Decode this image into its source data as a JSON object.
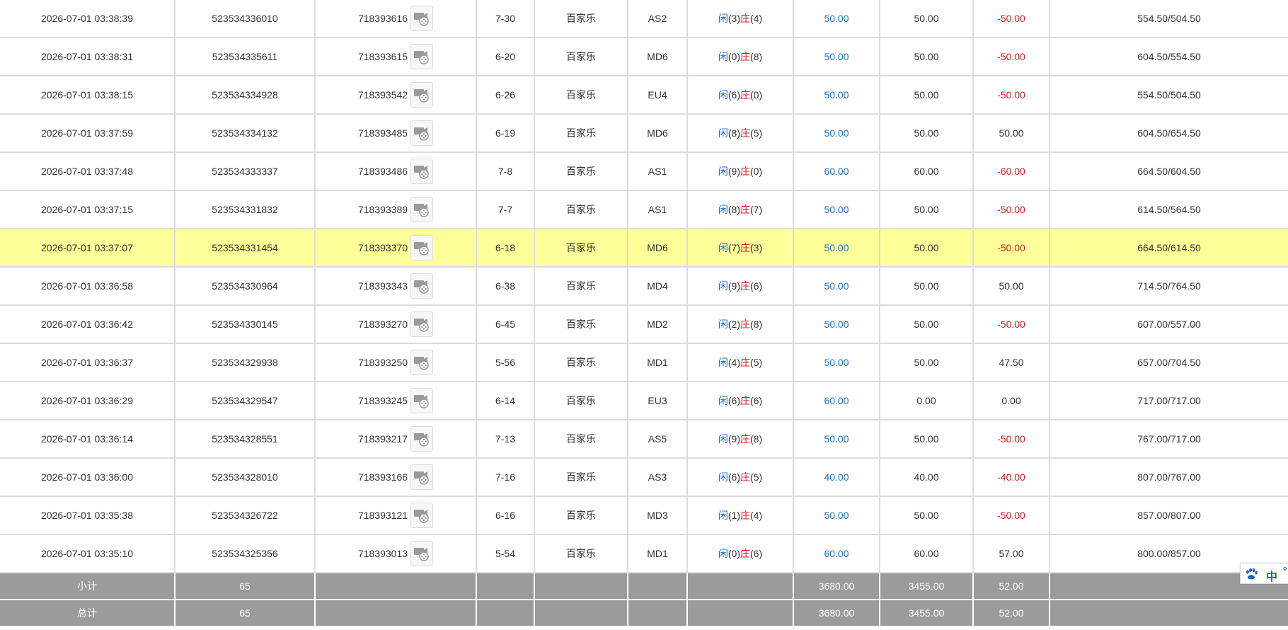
{
  "rows": [
    {
      "time": "2026-07-01 03:38:39",
      "order_no": "523534336010",
      "round_no": "718393616",
      "shoe": "7-30",
      "game": "百家乐",
      "table": "AS2",
      "player_label": "闲",
      "player_pts": "(3)",
      "banker_label": "庄",
      "banker_pts": "(4)",
      "bet": "50.00",
      "valid": "50.00",
      "payout": "-50.00",
      "payout_neg": true,
      "balance": "554.50/504.50",
      "highlight": false
    },
    {
      "time": "2026-07-01 03:38:31",
      "order_no": "523534335611",
      "round_no": "718393615",
      "shoe": "6-20",
      "game": "百家乐",
      "table": "MD6",
      "player_label": "闲",
      "player_pts": "(0)",
      "banker_label": "庄",
      "banker_pts": "(8)",
      "bet": "50.00",
      "valid": "50.00",
      "payout": "-50.00",
      "payout_neg": true,
      "balance": "604.50/554.50",
      "highlight": false
    },
    {
      "time": "2026-07-01 03:38:15",
      "order_no": "523534334928",
      "round_no": "718393542",
      "shoe": "6-26",
      "game": "百家乐",
      "table": "EU4",
      "player_label": "闲",
      "player_pts": "(6)",
      "banker_label": "庄",
      "banker_pts": "(0)",
      "bet": "50.00",
      "valid": "50.00",
      "payout": "-50.00",
      "payout_neg": true,
      "balance": "554.50/504.50",
      "highlight": false
    },
    {
      "time": "2026-07-01 03:37:59",
      "order_no": "523534334132",
      "round_no": "718393485",
      "shoe": "6-19",
      "game": "百家乐",
      "table": "MD6",
      "player_label": "闲",
      "player_pts": "(8)",
      "banker_label": "庄",
      "banker_pts": "(5)",
      "bet": "50.00",
      "valid": "50.00",
      "payout": "50.00",
      "payout_neg": false,
      "balance": "604.50/654.50",
      "highlight": false
    },
    {
      "time": "2026-07-01 03:37:48",
      "order_no": "523534333337",
      "round_no": "718393486",
      "shoe": "7-8",
      "game": "百家乐",
      "table": "AS1",
      "player_label": "闲",
      "player_pts": "(9)",
      "banker_label": "庄",
      "banker_pts": "(0)",
      "bet": "60.00",
      "valid": "60.00",
      "payout": "-60.00",
      "payout_neg": true,
      "balance": "664.50/604.50",
      "highlight": false
    },
    {
      "time": "2026-07-01 03:37:15",
      "order_no": "523534331832",
      "round_no": "718393389",
      "shoe": "7-7",
      "game": "百家乐",
      "table": "AS1",
      "player_label": "闲",
      "player_pts": "(8)",
      "banker_label": "庄",
      "banker_pts": "(7)",
      "bet": "50.00",
      "valid": "50.00",
      "payout": "-50.00",
      "payout_neg": true,
      "balance": "614.50/564.50",
      "highlight": false
    },
    {
      "time": "2026-07-01 03:37:07",
      "order_no": "523534331454",
      "round_no": "718393370",
      "shoe": "6-18",
      "game": "百家乐",
      "table": "MD6",
      "player_label": "闲",
      "player_pts": "(7)",
      "banker_label": "庄",
      "banker_pts": "(3)",
      "bet": "50.00",
      "valid": "50.00",
      "payout": "-50.00",
      "payout_neg": true,
      "balance": "664.50/614.50",
      "highlight": true
    },
    {
      "time": "2026-07-01 03:36:58",
      "order_no": "523534330964",
      "round_no": "718393343",
      "shoe": "6-38",
      "game": "百家乐",
      "table": "MD4",
      "player_label": "闲",
      "player_pts": "(9)",
      "banker_label": "庄",
      "banker_pts": "(6)",
      "bet": "50.00",
      "valid": "50.00",
      "payout": "50.00",
      "payout_neg": false,
      "balance": "714.50/764.50",
      "highlight": false
    },
    {
      "time": "2026-07-01 03:36:42",
      "order_no": "523534330145",
      "round_no": "718393270",
      "shoe": "6-45",
      "game": "百家乐",
      "table": "MD2",
      "player_label": "闲",
      "player_pts": "(2)",
      "banker_label": "庄",
      "banker_pts": "(8)",
      "bet": "50.00",
      "valid": "50.00",
      "payout": "-50.00",
      "payout_neg": true,
      "balance": "607.00/557.00",
      "highlight": false
    },
    {
      "time": "2026-07-01 03:36:37",
      "order_no": "523534329938",
      "round_no": "718393250",
      "shoe": "5-56",
      "game": "百家乐",
      "table": "MD1",
      "player_label": "闲",
      "player_pts": "(4)",
      "banker_label": "庄",
      "banker_pts": "(5)",
      "bet": "50.00",
      "valid": "50.00",
      "payout": "47.50",
      "payout_neg": false,
      "balance": "657.00/704.50",
      "highlight": false
    },
    {
      "time": "2026-07-01 03:36:29",
      "order_no": "523534329547",
      "round_no": "718393245",
      "shoe": "6-14",
      "game": "百家乐",
      "table": "EU3",
      "player_label": "闲",
      "player_pts": "(6)",
      "banker_label": "庄",
      "banker_pts": "(6)",
      "bet": "60.00",
      "valid": "0.00",
      "payout": "0.00",
      "payout_neg": false,
      "balance": "717.00/717.00",
      "highlight": false
    },
    {
      "time": "2026-07-01 03:36:14",
      "order_no": "523534328551",
      "round_no": "718393217",
      "shoe": "7-13",
      "game": "百家乐",
      "table": "AS5",
      "player_label": "闲",
      "player_pts": "(9)",
      "banker_label": "庄",
      "banker_pts": "(8)",
      "bet": "50.00",
      "valid": "50.00",
      "payout": "-50.00",
      "payout_neg": true,
      "balance": "767.00/717.00",
      "highlight": false
    },
    {
      "time": "2026-07-01 03:36:00",
      "order_no": "523534328010",
      "round_no": "718393166",
      "shoe": "7-16",
      "game": "百家乐",
      "table": "AS3",
      "player_label": "闲",
      "player_pts": "(6)",
      "banker_label": "庄",
      "banker_pts": "(5)",
      "bet": "40.00",
      "valid": "40.00",
      "payout": "-40.00",
      "payout_neg": true,
      "balance": "807.00/767.00",
      "highlight": false
    },
    {
      "time": "2026-07-01 03:35:38",
      "order_no": "523534326722",
      "round_no": "718393121",
      "shoe": "6-16",
      "game": "百家乐",
      "table": "MD3",
      "player_label": "闲",
      "player_pts": "(1)",
      "banker_label": "庄",
      "banker_pts": "(4)",
      "bet": "50.00",
      "valid": "50.00",
      "payout": "-50.00",
      "payout_neg": true,
      "balance": "857.00/807.00",
      "highlight": false
    },
    {
      "time": "2026-07-01 03:35:10",
      "order_no": "523534325356",
      "round_no": "718393013",
      "shoe": "5-54",
      "game": "百家乐",
      "table": "MD1",
      "player_label": "闲",
      "player_pts": "(0)",
      "banker_label": "庄",
      "banker_pts": "(6)",
      "bet": "60.00",
      "valid": "60.00",
      "payout": "57.00",
      "payout_neg": false,
      "balance": "800.00/857.00",
      "highlight": false
    }
  ],
  "subtotal": {
    "label": "小计",
    "count": "65",
    "bet": "3680.00",
    "valid": "3455.00",
    "payout": "52.00"
  },
  "total": {
    "label": "总计",
    "count": "65",
    "bet": "3680.00",
    "valid": "3455.00",
    "payout": "52.00"
  },
  "ime": {
    "lang": "中",
    "extra": "°",
    "icon": "paw-icon"
  },
  "colors": {
    "highlight": "#ffff99",
    "player": "#1e6fdc",
    "banker": "#e0191b",
    "negative": "#e0191b",
    "summary_bg": "#9b9b9b"
  },
  "icons": {
    "replay": "video-replay-icon"
  }
}
